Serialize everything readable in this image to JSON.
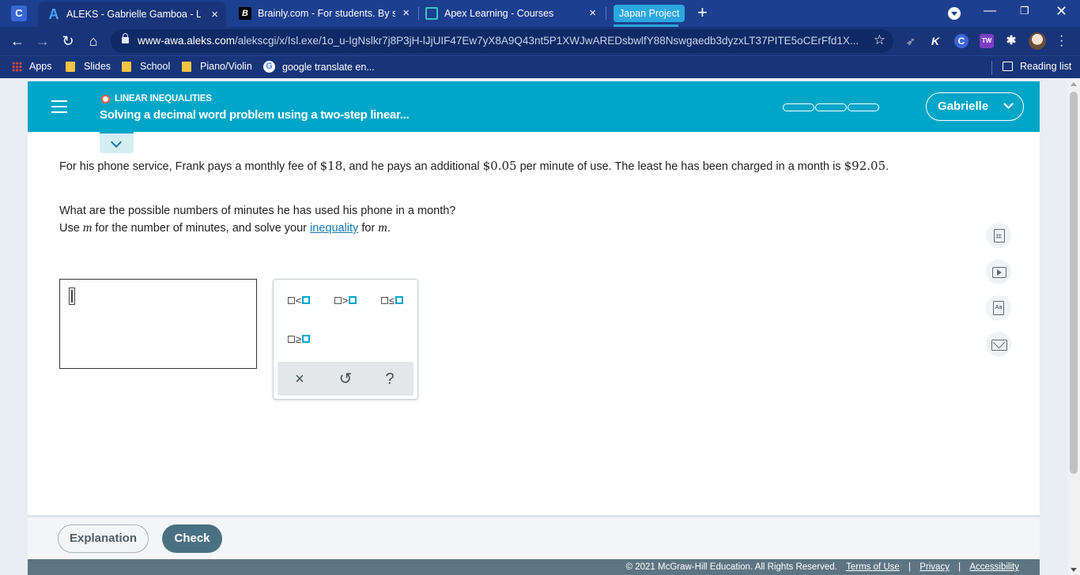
{
  "browser": {
    "tabs": [
      {
        "title": "ALEKS - Gabrielle Gamboa - Lear",
        "icon": "aleks-icon",
        "active": true
      },
      {
        "title": "Brainly.com - For students. By stu",
        "icon": "brainly-icon"
      },
      {
        "title": "Apex Learning - Courses",
        "icon": "apex-icon"
      }
    ],
    "tab_group_label": "Japan Project",
    "url_host": "www-awa.aleks.com",
    "url_path": "/alekscgi/x/Isl.exe/1o_u-IgNslkr7j8P3jH-lJjUIF47Ew7yX8A9Q43nt5P1XWJwAREDsbwlfY88Nswgaedb3dyzxLT37PITE5oCErFfd1X...",
    "extensions": [
      "K",
      "C",
      "TW"
    ],
    "bookmarks": [
      "Apps",
      "Slides",
      "School",
      "Piano/Violin",
      "google translate en..."
    ],
    "reading_list_label": "Reading list"
  },
  "header": {
    "category": "LINEAR INEQUALITIES",
    "title": "Solving a decimal word problem using a two-step linear...",
    "progress_segments": 3,
    "user_name": "Gabrielle"
  },
  "question": {
    "p1_a": "For his phone service, Frank pays a monthly fee of ",
    "fee": "$18",
    "p1_b": ", and he pays an additional ",
    "rate": "$0.05",
    "p1_c": " per minute of use. The least he has been charged in a month is ",
    "least": "$92.05",
    "p1_d": ".",
    "p2": "What are the possible numbers of minutes he has used his phone in a month?",
    "p3_a": "Use ",
    "var": "m",
    "p3_b": " for the number of minutes, and solve your ",
    "link": "inequality",
    "p3_c": " for ",
    "p3_d": "."
  },
  "keypad": {
    "ops": [
      "<",
      ">",
      "≤",
      "≥"
    ],
    "clear_symbol": "×",
    "undo_symbol": "↺",
    "help_symbol": "?"
  },
  "footer": {
    "explanation_label": "Explanation",
    "check_label": "Check",
    "copyright": "© 2021 McGraw-Hill Education. All Rights Reserved.",
    "terms": "Terms of Use",
    "privacy": "Privacy",
    "accessibility": "Accessibility"
  },
  "colors": {
    "header_teal": "#00a6c8",
    "browser_blue": "#18357a",
    "check_button": "#4a7182"
  }
}
